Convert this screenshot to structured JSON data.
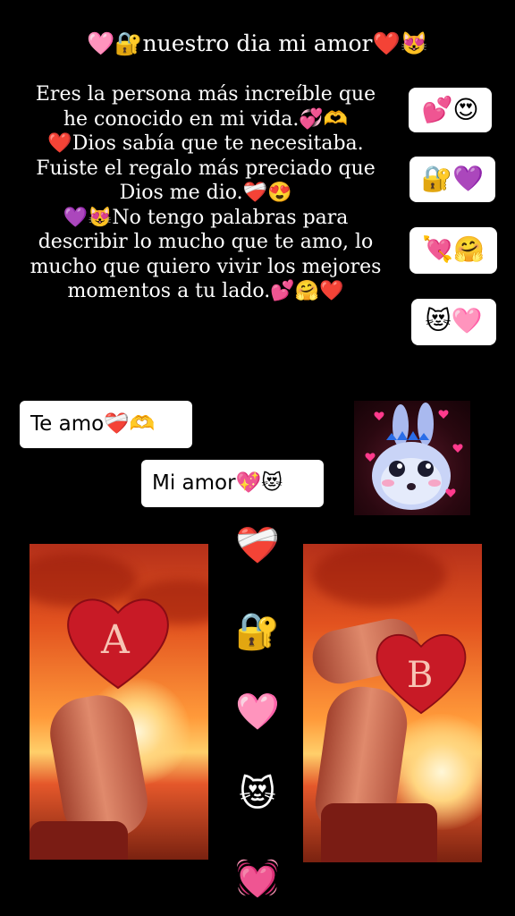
{
  "title": "🩷🔐nuestro dia mi amor❤️😻",
  "message_lines": [
    "Eres la persona más increíble que",
    "he conocido en mi vida.💞🫶",
    "❤️Dios sabía que te necesitaba.",
    "Fuiste el regalo más preciado que",
    "Dios me dio.❤️‍🩹😍",
    "💜😻No tengo palabras para",
    "describir lo mucho que te amo, lo",
    "mucho que quiero vivir los mejores",
    "momentos a tu lado.💕🤗❤️"
  ],
  "emoji_boxes": [
    "💕😍",
    "🔐💜",
    "💘🤗",
    "😻🩷"
  ],
  "bubbles": {
    "te_amo": "Te amo❤️‍🩹🫶",
    "mi_amor": "Mi amor💖😻"
  },
  "photos": {
    "left_letter": "A",
    "right_letter": "B"
  },
  "column_emojis": [
    "❤️‍🩹",
    "🔐",
    "🩷",
    "😻",
    "💓"
  ],
  "colors": {
    "background": "#000000",
    "box": "#ffffff",
    "heart": "#d81e2c"
  }
}
